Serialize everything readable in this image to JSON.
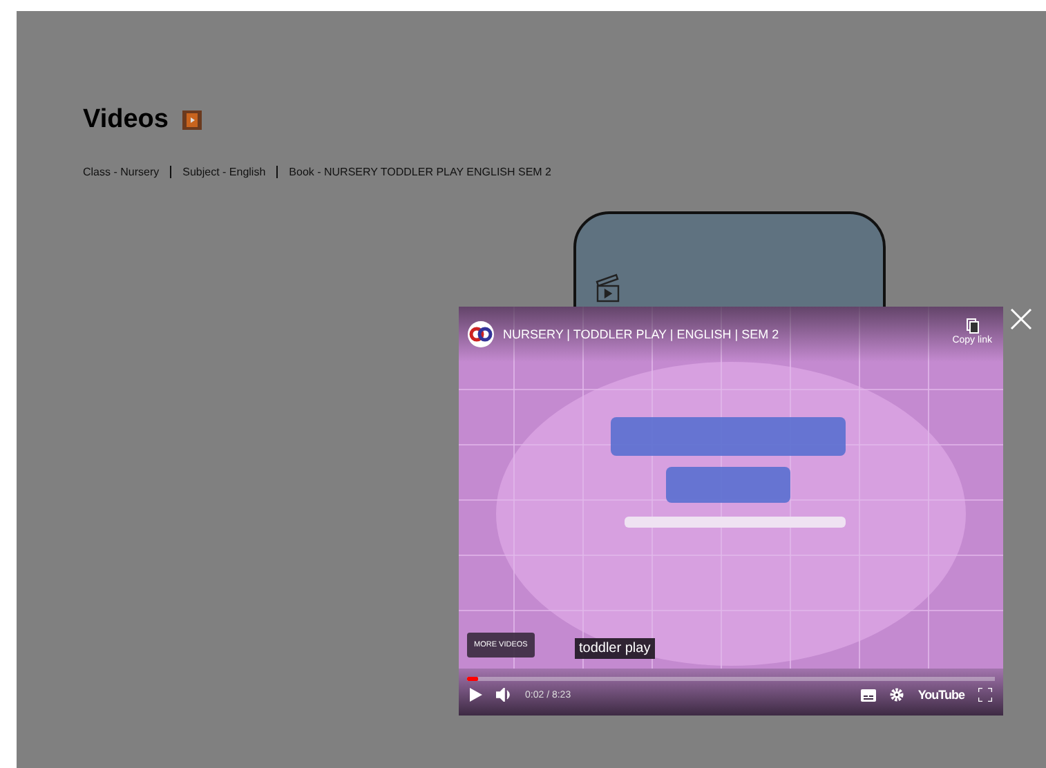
{
  "page": {
    "title": "Videos",
    "breadcrumb": [
      {
        "text": "Class - Nursery"
      },
      {
        "text": "Subject - English"
      },
      {
        "text": "Book - NURSERY TODDLER PLAY ENGLISH SEM 2"
      }
    ]
  },
  "player": {
    "title": "NURSERY | TODDLER PLAY | ENGLISH | SEM 2",
    "copy_link": "Copy link",
    "more_videos": "MORE VIDEOS",
    "caption": "toddler play",
    "time": "0:02 / 8:23",
    "level": 0.02,
    "brand": "YouTube"
  }
}
